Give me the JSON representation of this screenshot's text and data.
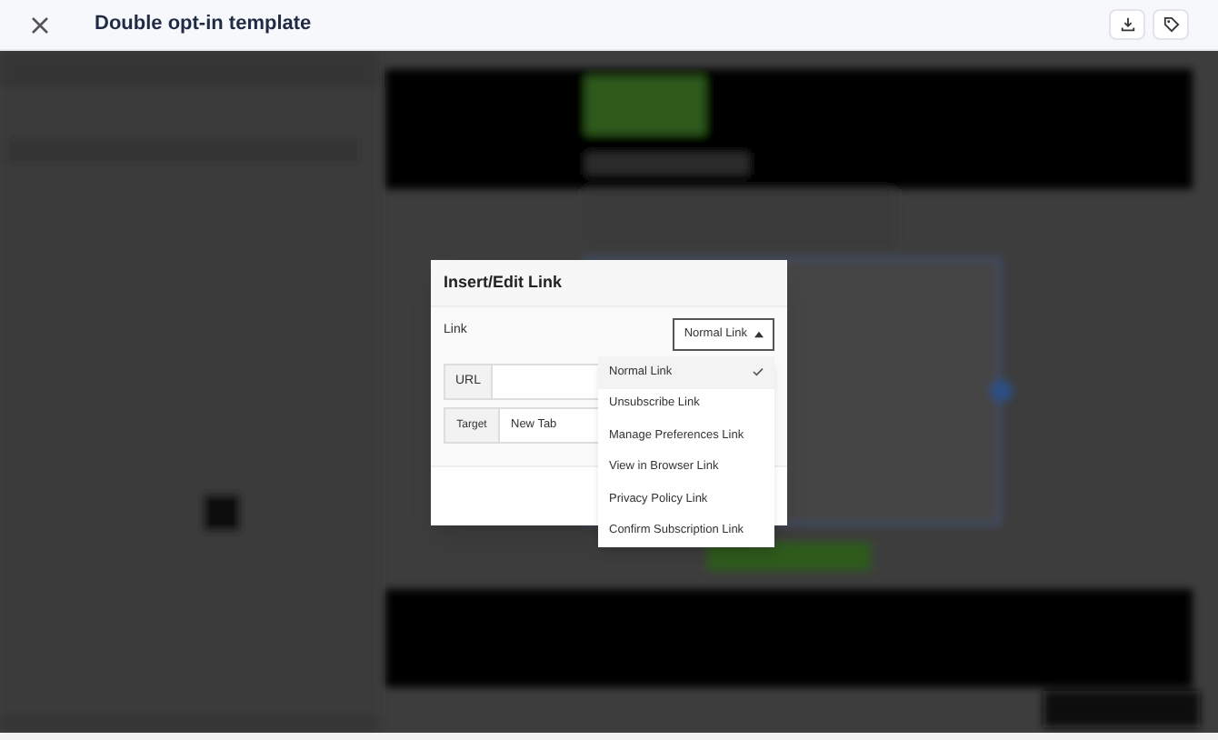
{
  "window": {
    "title": "Double opt-in template"
  },
  "dialog": {
    "title": "Insert/Edit Link",
    "link_label": "Link",
    "link_type": {
      "value": "Normal Link",
      "expanded": true
    },
    "fields": [
      {
        "label": "URL"
      },
      {
        "label": "Target",
        "value": "New Tab"
      }
    ],
    "options": [
      {
        "label": "Normal Link",
        "selected": true
      },
      {
        "label": "Unsubscribe Link",
        "selected": false
      },
      {
        "label": "Manage Preferences Link",
        "selected": false
      },
      {
        "label": "View in Browser Link",
        "selected": false
      },
      {
        "label": "Privacy Policy Link",
        "selected": false
      },
      {
        "label": "Confirm Subscription Link",
        "selected": false
      }
    ]
  }
}
